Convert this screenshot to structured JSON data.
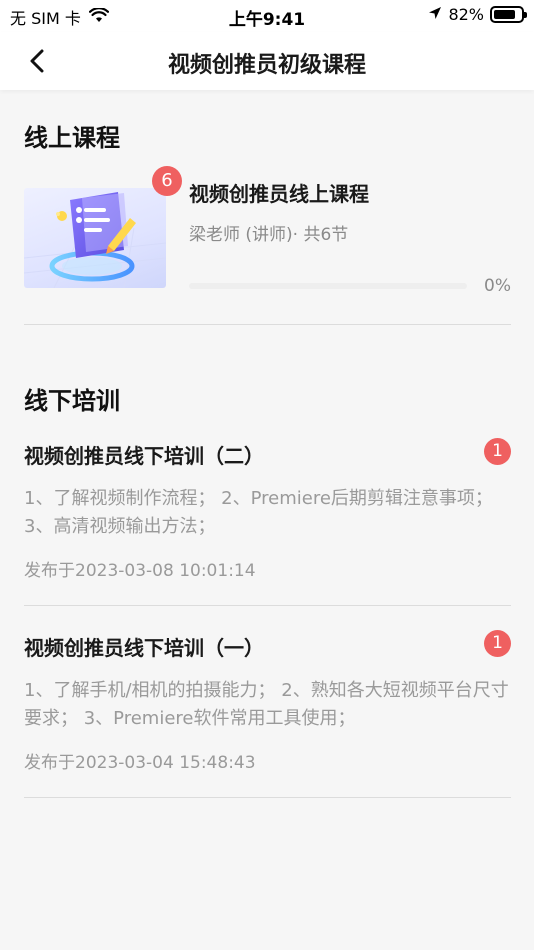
{
  "status_bar": {
    "carrier": "无 SIM 卡",
    "time": "上午9:41",
    "battery_percent": "82%",
    "battery_level": 0.82
  },
  "nav": {
    "title": "视频创推员初级课程"
  },
  "online": {
    "section_title": "线上课程",
    "course": {
      "badge": "6",
      "title": "视频创推员线上课程",
      "meta": "梁老师 (讲师)· 共6节",
      "progress_text": "0%",
      "progress_value": 0
    }
  },
  "offline": {
    "section_title": "线下培训",
    "items": [
      {
        "title": "视频创推员线下培训（二）",
        "badge": "1",
        "desc": "1、了解视频制作流程； 2、Premiere后期剪辑注意事项； 3、高清视频输出方法；",
        "date": "发布于2023-03-08 10:01:14"
      },
      {
        "title": "视频创推员线下培训（一）",
        "badge": "1",
        "desc": "1、了解手机/相机的拍摄能力； 2、熟知各大短视频平台尺寸要求； 3、Premiere软件常用工具使用；",
        "date": "发布于2023-03-04 15:48:43"
      }
    ]
  },
  "colors": {
    "accent": "#ef6060",
    "background": "#f6f6f6"
  }
}
